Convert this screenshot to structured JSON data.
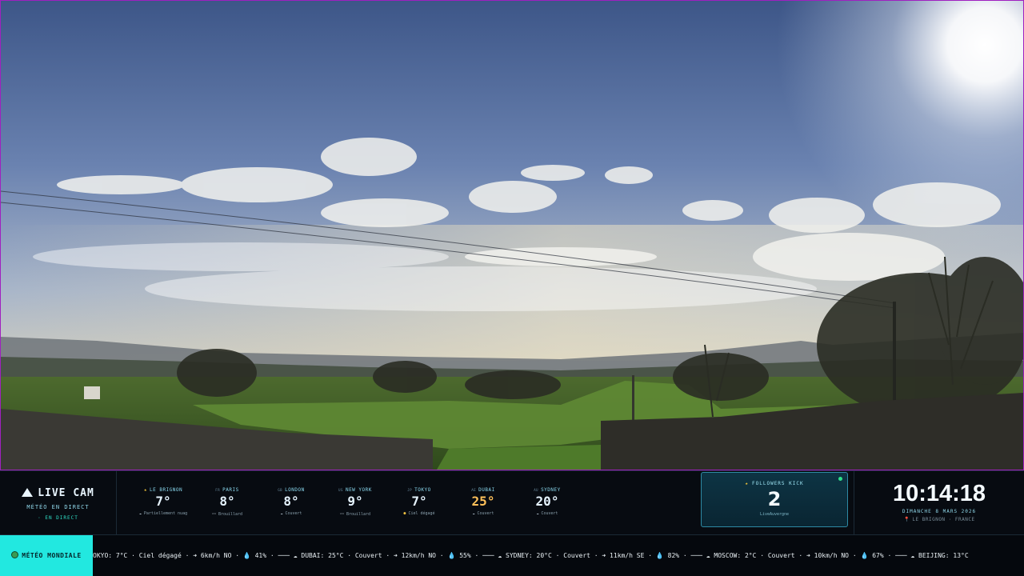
{
  "brand": {
    "title": "LIVE CAM",
    "subtitle": "MÉTÉO EN DIRECT",
    "status": "· EN DIRECT"
  },
  "cities": [
    {
      "code": "",
      "name": "LE BRIGNON",
      "home": true,
      "temp": "7°",
      "condition": "Partiellement nuag",
      "icon": "cloud-sun-icon",
      "hot": false
    },
    {
      "code": "FR",
      "name": "PARIS",
      "home": false,
      "temp": "8°",
      "condition": "Brouillard",
      "icon": "fog-icon",
      "hot": false
    },
    {
      "code": "GB",
      "name": "LONDON",
      "home": false,
      "temp": "8°",
      "condition": "Couvert",
      "icon": "cloud-icon",
      "hot": false
    },
    {
      "code": "US",
      "name": "NEW YORK",
      "home": false,
      "temp": "9°",
      "condition": "Brouillard",
      "icon": "fog-icon",
      "hot": false
    },
    {
      "code": "JP",
      "name": "TOKYO",
      "home": false,
      "temp": "7°",
      "condition": "Ciel dégagé",
      "icon": "sun-icon",
      "hot": false
    },
    {
      "code": "AE",
      "name": "DUBAI",
      "home": false,
      "temp": "25°",
      "condition": "Couvert",
      "icon": "cloud-icon",
      "hot": true
    },
    {
      "code": "AU",
      "name": "SYDNEY",
      "home": false,
      "temp": "20°",
      "condition": "Couvert",
      "icon": "cloud-icon",
      "hot": false
    }
  ],
  "followers": {
    "label": "FOLLOWERS KICK",
    "count": "2",
    "user": "LiveAuvergne"
  },
  "clock": {
    "time": "10:14:18",
    "date": "DIMANCHE 8 MARS 2026",
    "location": "LE BRIGNON · FRANCE"
  },
  "ticker": {
    "label": "MÉTÉO MONDIALE",
    "text": "OKYO: 7°C · Ciel dégagé · ➜ 6km/h NO · 💧 41% · ─── ☁ DUBAI: 25°C · Couvert · ➜ 12km/h NO · 💧 55% · ─── ☁ SYDNEY: 20°C · Couvert · ➜ 11km/h SE · 💧 82% · ─── ☁ MOSCOW: 2°C · Couvert · ➜ 10km/h NO · 💧 67% · ─── ☁ BEIJING: 13°C"
  },
  "colors": {
    "accent": "#22e8e0",
    "frame": "#a020c0",
    "hot_temp": "#ffc15a",
    "panel": "#070b11"
  }
}
